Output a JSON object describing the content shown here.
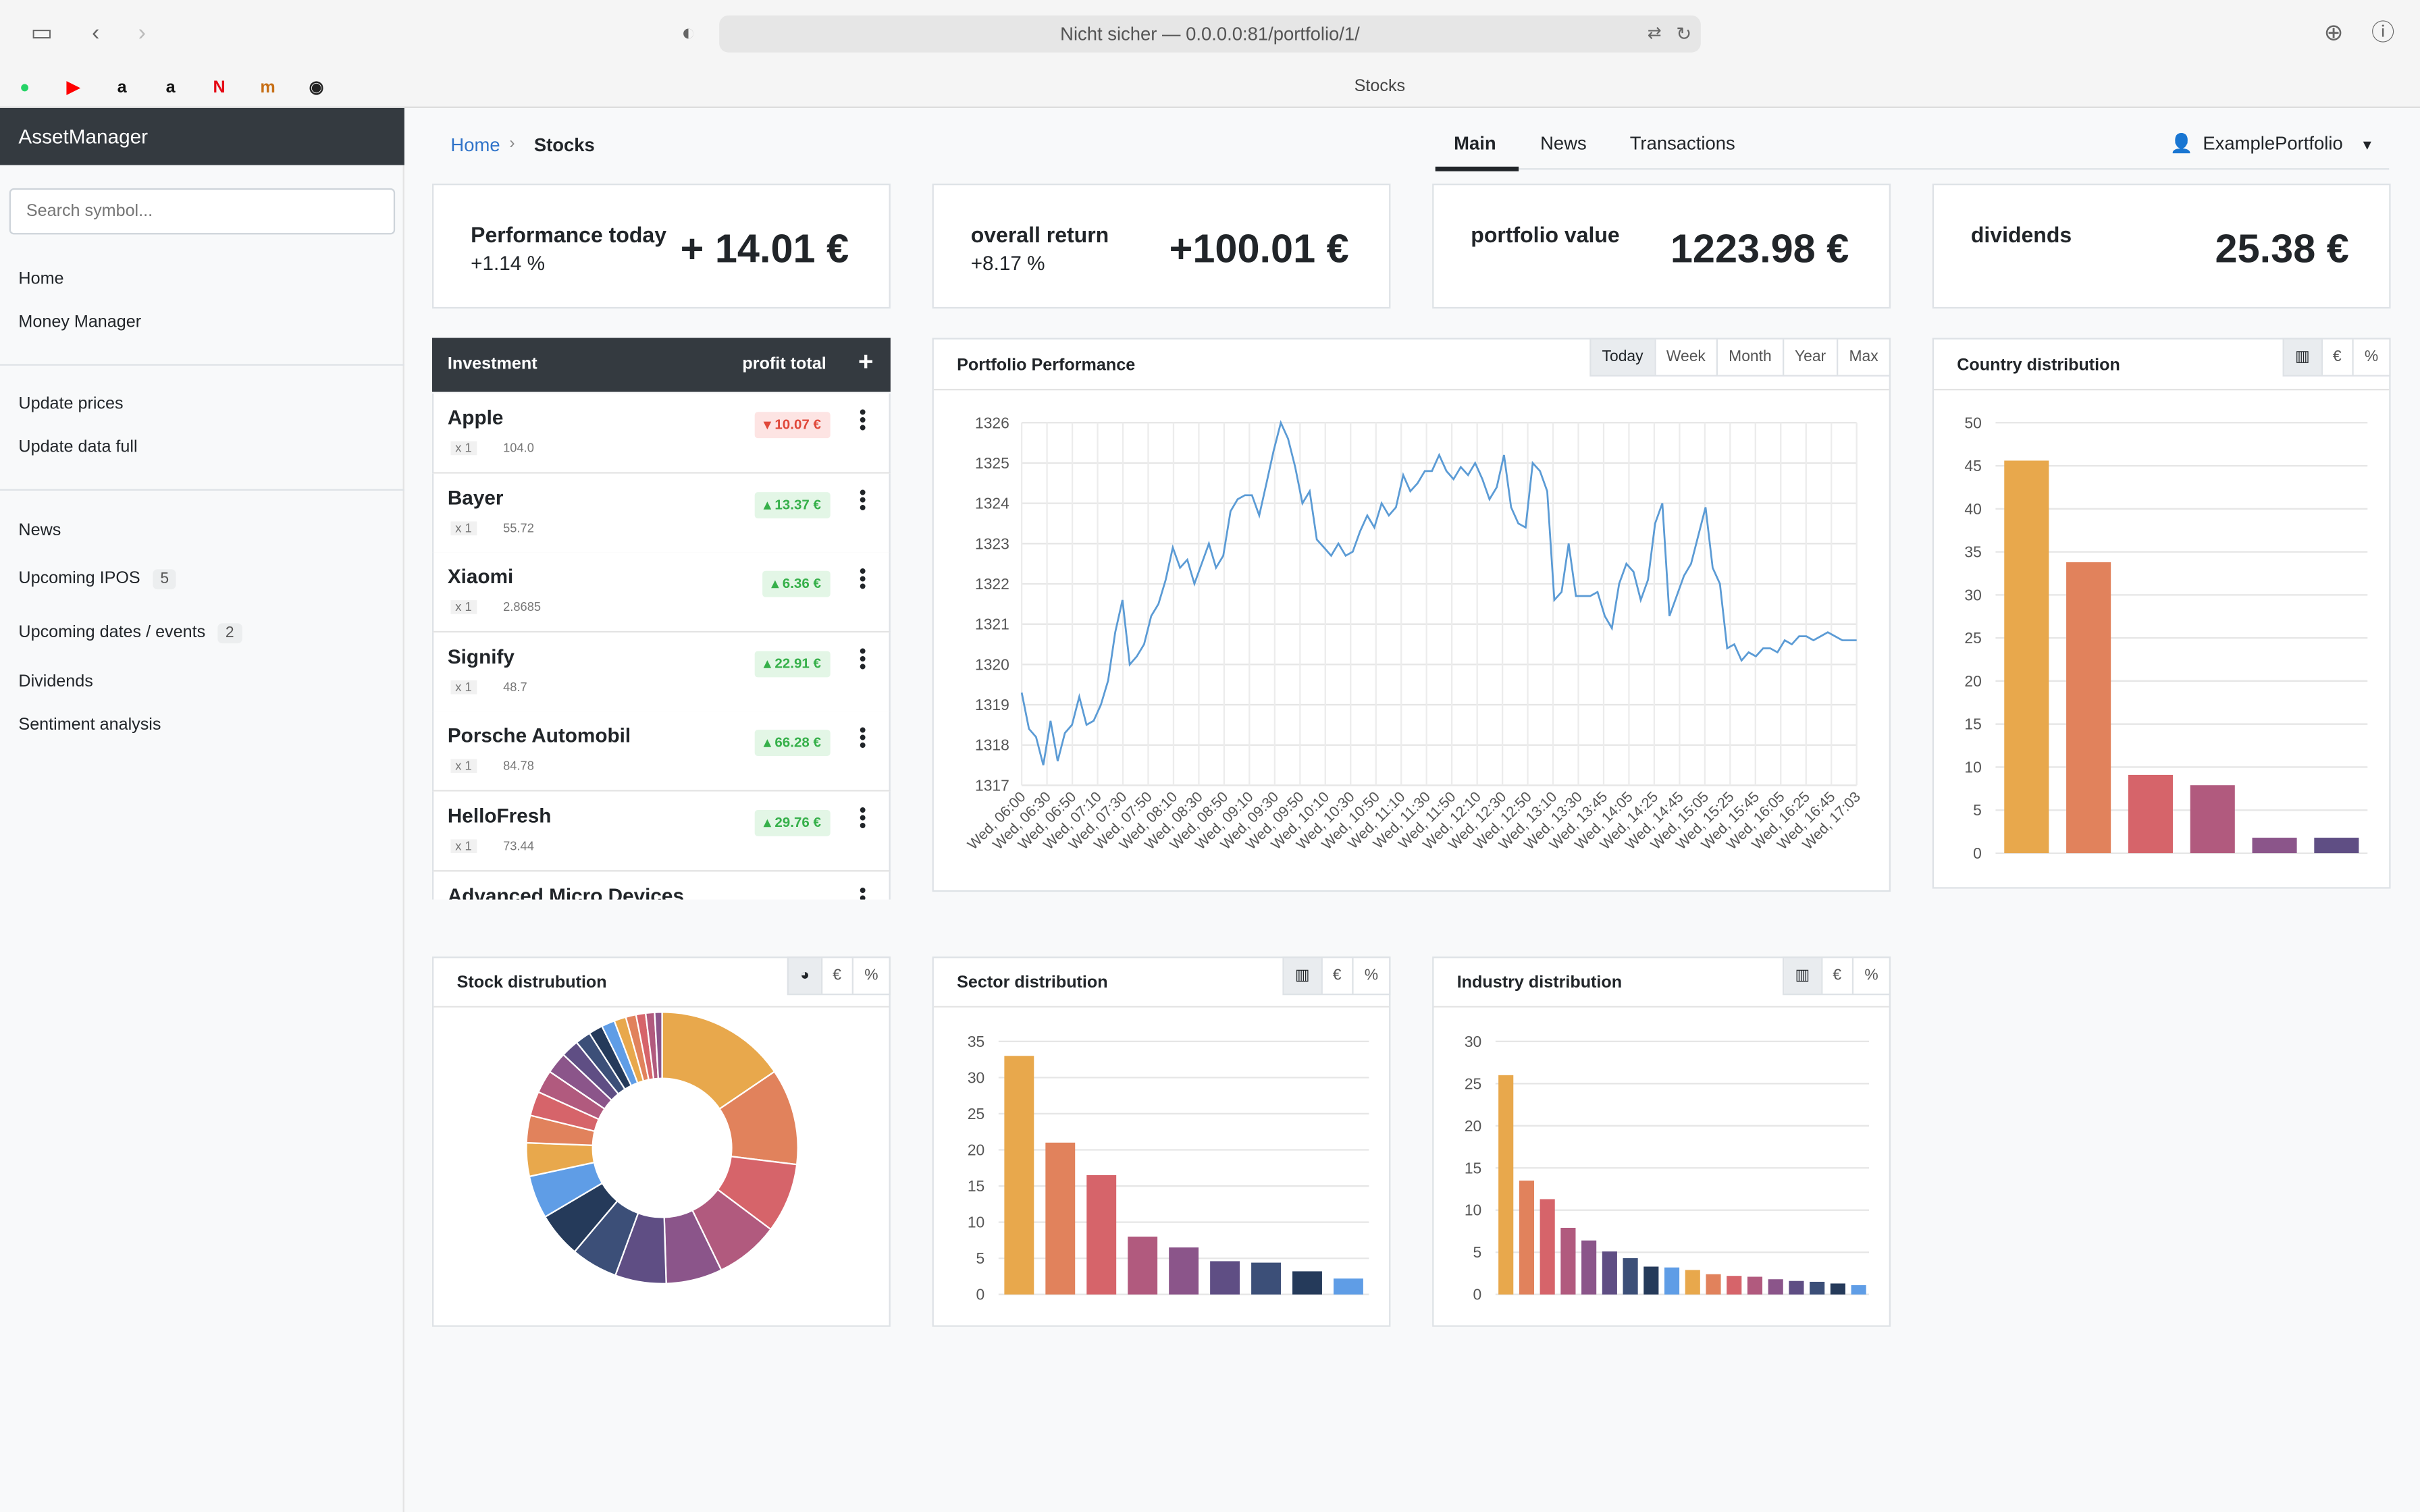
{
  "browser": {
    "url": "Nicht sicher — 0.0.0.0:81/portfolio/1/",
    "tab_title": "Stocks",
    "bookmarks": [
      {
        "icon": "whatsapp-icon",
        "glyph": "●",
        "color": "#25d366"
      },
      {
        "icon": "youtube-icon",
        "glyph": "▶",
        "color": "#ff0000"
      },
      {
        "icon": "amazon-icon",
        "glyph": "a",
        "color": "#111111"
      },
      {
        "icon": "amazon-icon",
        "glyph": "a",
        "color": "#111111"
      },
      {
        "icon": "netflix-icon",
        "glyph": "N",
        "color": "#e50914"
      },
      {
        "icon": "bookmark-m-icon",
        "glyph": "m",
        "color": "#c76f16"
      },
      {
        "icon": "github-icon",
        "glyph": "◉",
        "color": "#222222"
      }
    ]
  },
  "sidebar": {
    "brand": "AssetManager",
    "search_placeholder": "Search symbol...",
    "group1": [
      "Home",
      "Money Manager"
    ],
    "group2": [
      "Update prices",
      "Update data full"
    ],
    "group3": [
      {
        "label": "News",
        "badge": ""
      },
      {
        "label": "Upcoming IPOS",
        "badge": "5"
      },
      {
        "label": "Upcoming dates / events",
        "badge": "2"
      },
      {
        "label": "Dividends",
        "badge": ""
      },
      {
        "label": "Sentiment analysis",
        "badge": ""
      }
    ]
  },
  "breadcrumb": {
    "home": "Home",
    "current": "Stocks"
  },
  "tabs": [
    "Main",
    "News",
    "Transactions"
  ],
  "portfolio_selector": "ExamplePortfolio",
  "kpis": [
    {
      "label": "Performance today",
      "sub": "+1.14 %",
      "value": "+ 14.01 €"
    },
    {
      "label": "overall return",
      "sub": "+8.17 %",
      "value": "+100.01 €"
    },
    {
      "label": "portfolio value",
      "sub": "",
      "value": "1223.98 €"
    },
    {
      "label": "dividends",
      "sub": "",
      "value": "25.38 €"
    }
  ],
  "investments": {
    "header_name": "Investment",
    "header_profit": "profit total",
    "add_label": "+",
    "rows": [
      {
        "name": "Apple",
        "qty": "x 1",
        "price": "104.0",
        "profit": "10.07 €",
        "dir": "neg"
      },
      {
        "name": "Bayer",
        "qty": "x 1",
        "price": "55.72",
        "profit": "13.37 €",
        "dir": "pos"
      },
      {
        "name": "Xiaomi",
        "qty": "x 1",
        "price": "2.8685",
        "profit": "6.36 €",
        "dir": "pos"
      },
      {
        "name": "Signify",
        "qty": "x 1",
        "price": "48.7",
        "profit": "22.91 €",
        "dir": "pos"
      },
      {
        "name": "Porsche Automobil",
        "qty": "x 1",
        "price": "84.78",
        "profit": "66.28 €",
        "dir": "pos"
      },
      {
        "name": "HelloFresh",
        "qty": "x 1",
        "price": "73.44",
        "profit": "29.76 €",
        "dir": "pos"
      },
      {
        "name": "Advanced Micro Devices",
        "qty": "",
        "price": "",
        "profit": "",
        "dir": "pos"
      }
    ]
  },
  "performance": {
    "title": "Portfolio Performance",
    "ranges": [
      "Today",
      "Week",
      "Month",
      "Year",
      "Max"
    ],
    "active_range": "Today"
  },
  "country": {
    "title": "Country distribution"
  },
  "stock": {
    "title": "Stock distrubution"
  },
  "sector": {
    "title": "Sector distribution"
  },
  "industry": {
    "title": "Industry distribution"
  },
  "palette": [
    "#e8a84c",
    "#e1825c",
    "#d6646a",
    "#b15a7e",
    "#8b558a",
    "#5f4e84",
    "#3c4f78",
    "#253a5a",
    "#5f9de6"
  ],
  "chart_data": [
    {
      "type": "line",
      "title": "Portfolio Performance",
      "ylim": [
        1317,
        1326
      ],
      "x": [
        "Wed, 06:00",
        "Wed, 06:30",
        "Wed, 06:50",
        "Wed, 07:10",
        "Wed, 07:30",
        "Wed, 07:50",
        "Wed, 08:10",
        "Wed, 08:30",
        "Wed, 08:50",
        "Wed, 09:10",
        "Wed, 09:30",
        "Wed, 09:50",
        "Wed, 10:10",
        "Wed, 10:30",
        "Wed, 10:50",
        "Wed, 11:10",
        "Wed, 11:30",
        "Wed, 11:50",
        "Wed, 12:10",
        "Wed, 12:30",
        "Wed, 12:50",
        "Wed, 13:10",
        "Wed, 13:30",
        "Wed, 13:45",
        "Wed, 14:05",
        "Wed, 14:25",
        "Wed, 14:45",
        "Wed, 15:05",
        "Wed, 15:25",
        "Wed, 15:45",
        "Wed, 16:05",
        "Wed, 16:25",
        "Wed, 16:45",
        "Wed, 17:03"
      ],
      "series": [
        {
          "values": [
            1319.3,
            1318.4,
            1318.2,
            1317.5,
            1318.6,
            1317.6,
            1318.3,
            1318.5,
            1319.2,
            1318.5,
            1318.6,
            1319.0,
            1319.6,
            1320.8,
            1321.6,
            1320.0,
            1320.2,
            1320.5,
            1321.2,
            1321.5,
            1322.1,
            1322.9,
            1322.4,
            1322.6,
            1322.0,
            1322.5,
            1323.0,
            1322.4,
            1322.7,
            1323.8,
            1324.1,
            1324.2,
            1324.2,
            1323.7,
            1324.5,
            1325.3,
            1326.0,
            1325.6,
            1324.9,
            1324.0,
            1324.3,
            1323.1,
            1322.9,
            1322.7,
            1323.0,
            1322.7,
            1322.8,
            1323.3,
            1323.7,
            1323.4,
            1324.0,
            1323.7,
            1323.9,
            1324.7,
            1324.3,
            1324.5,
            1324.8,
            1324.8,
            1325.2,
            1324.8,
            1324.6,
            1324.9,
            1324.7,
            1325.0,
            1324.6,
            1324.1,
            1324.4,
            1325.2,
            1323.9,
            1323.5,
            1323.4,
            1325.0,
            1324.8,
            1324.3,
            1321.6,
            1321.8,
            1323.0,
            1321.7,
            1321.7,
            1321.7,
            1321.8,
            1321.2,
            1320.9,
            1322.0,
            1322.5,
            1322.3,
            1321.6,
            1322.1,
            1323.5,
            1324.0,
            1321.2,
            1321.7,
            1322.2,
            1322.5,
            1323.2,
            1323.9,
            1322.4,
            1322.0,
            1320.4,
            1320.5,
            1320.1,
            1320.3,
            1320.2,
            1320.4,
            1320.4,
            1320.3,
            1320.6,
            1320.5,
            1320.7,
            1320.7,
            1320.6,
            1320.7,
            1320.8,
            1320.7,
            1320.6,
            1320.6,
            1320.6
          ]
        }
      ]
    },
    {
      "type": "bar",
      "title": "Country distribution",
      "ylim": [
        0,
        50
      ],
      "yticks": [
        0,
        5,
        10,
        15,
        20,
        25,
        30,
        35,
        40,
        45,
        50
      ],
      "values": [
        45.6,
        33.8,
        9.1,
        7.9,
        1.8,
        1.8
      ]
    },
    {
      "type": "pie",
      "title": "Stock distrubution",
      "values": [
        17.6,
        13.0,
        9.4,
        8.6,
        7.6,
        6.9,
        6.3,
        6.1,
        5.8,
        4.5,
        3.7,
        3.3,
        3.1,
        2.9,
        2.4,
        2.1,
        1.9,
        1.8,
        1.6,
        1.4,
        1.3,
        1.2,
        1.0
      ]
    },
    {
      "type": "bar",
      "title": "Sector distribution",
      "ylim": [
        0,
        35
      ],
      "yticks": [
        0,
        5,
        10,
        15,
        20,
        25,
        30,
        35
      ],
      "values": [
        33,
        21,
        16.5,
        8,
        6.5,
        4.6,
        4.4,
        3.2,
        2.2
      ]
    },
    {
      "type": "bar",
      "title": "Industry distribution",
      "ylim": [
        0,
        30
      ],
      "yticks": [
        0,
        5,
        10,
        15,
        20,
        25,
        30
      ],
      "values": [
        26,
        13.5,
        11.3,
        7.9,
        6.4,
        5.1,
        4.3,
        3.3,
        3.2,
        2.9,
        2.4,
        2.2,
        2.1,
        1.8,
        1.6,
        1.5,
        1.3,
        1.1
      ]
    }
  ]
}
